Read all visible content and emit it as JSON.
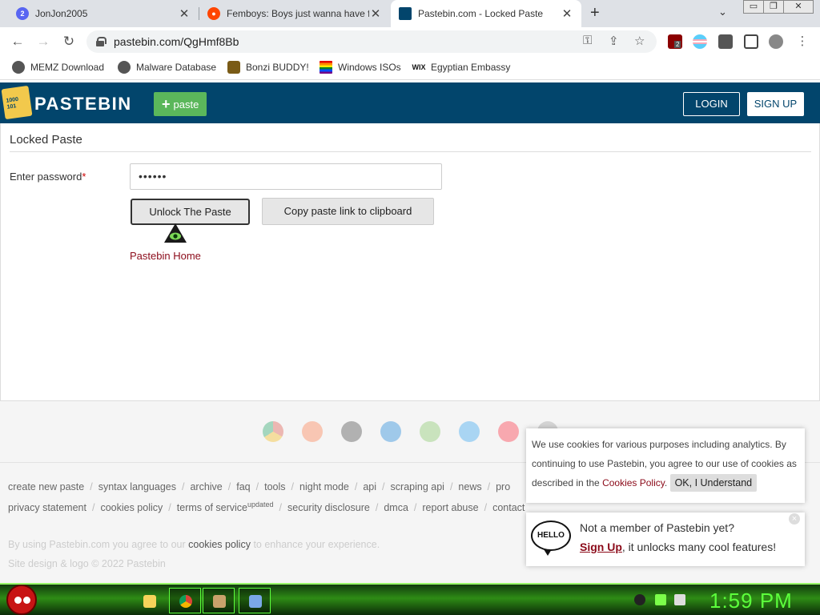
{
  "browser": {
    "tabs": [
      {
        "title": "JonJon2005",
        "favicon": "twitch-icon",
        "color": "#5865f2"
      },
      {
        "title": "Femboys: Boys just wanna have fun",
        "favicon": "reddit-icon",
        "color": "#ff4500"
      },
      {
        "title": "Pastebin.com - Locked Paste",
        "favicon": "pastebin-icon",
        "color": "#02456c"
      }
    ],
    "new_tab": "+",
    "tab_list": "⌄",
    "window_controls": [
      "▭",
      "❐",
      "✕"
    ],
    "url": "pastebin.com/QgHmf8Bb",
    "nav": {
      "back": "←",
      "forward": "→",
      "reload": "↻"
    },
    "omnibox_icons": [
      "key-icon",
      "share-icon",
      "star-icon"
    ],
    "extension_badge": "2"
  },
  "bookmarks": [
    {
      "label": "MEMZ Download",
      "icon": "globe-icon",
      "color": "#555555"
    },
    {
      "label": "Malware Database",
      "icon": "globe-icon",
      "color": "#555555"
    },
    {
      "label": "Bonzi BUDDY!",
      "icon": "bonzi-icon",
      "color": "#7a5b16"
    },
    {
      "label": "Windows ISOs",
      "icon": "rainbow-flag-icon",
      "color": "#e40303"
    },
    {
      "label": "Egyptian Embassy",
      "icon": "wix-icon",
      "color": "#111111"
    }
  ],
  "pastebin": {
    "brand": "PASTEBIN",
    "paste_button": "paste",
    "login": "LOGIN",
    "signup": "SIGN UP",
    "page_title": "Locked Paste",
    "password_label": "Enter password",
    "password_required_mark": "*",
    "password_value": "••••••",
    "unlock_button": "Unlock The Paste",
    "copy_button": "Copy paste link to clipboard",
    "home_link": "Pastebin Home"
  },
  "footer": {
    "app_icons": [
      "chrome-icon",
      "firefox-icon",
      "ios-icon",
      "windows-icon",
      "android-icon",
      "x-icon",
      "opera-icon",
      "other-icon"
    ],
    "links_row1": [
      "create new paste",
      "syntax languages",
      "archive",
      "faq",
      "tools",
      "night mode",
      "api",
      "scraping api",
      "news",
      "pro"
    ],
    "links_row2": [
      "privacy statement",
      "cookies policy",
      "terms of service",
      "security disclosure",
      "dmca",
      "report abuse",
      "contact"
    ],
    "terms_sup": "updated",
    "note1_pre": "By using Pastebin.com you agree to our ",
    "note1_link": "cookies policy",
    "note1_post": " to enhance your experience.",
    "note2": "Site design & logo © 2022 Pastebin"
  },
  "cookie_popup": {
    "text_pre": "We use cookies for various purposes including analytics. By continuing to use Pastebin, you agree to our use of cookies as described in the ",
    "link": "Cookies Policy",
    "text_post": ".",
    "ok": "OK, I Understand"
  },
  "hello_popup": {
    "icon_text": "HELLO",
    "line1": "Not a member of Pastebin yet?",
    "signup": "Sign Up",
    "line2_post": ", it unlocks many cool features!",
    "close": "×"
  },
  "taskbar": {
    "clock": "1:59 PM"
  }
}
